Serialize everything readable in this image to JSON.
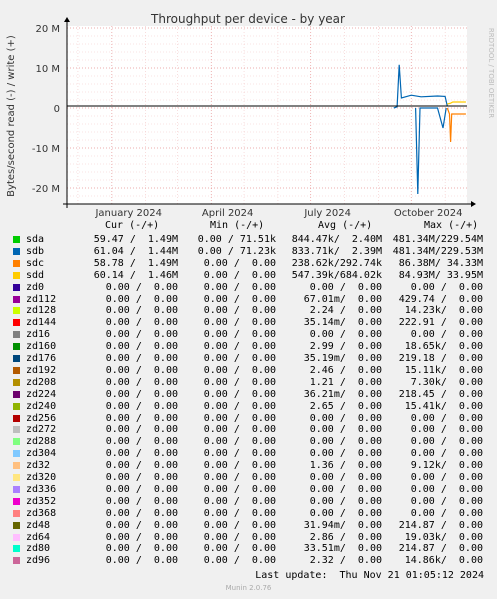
{
  "chart_data": {
    "type": "line",
    "title": "Throughput per device - by year",
    "ylabel": "Bytes/second read (-) / write (+)",
    "y_ticks": [
      "20 M",
      "10 M",
      "0",
      "-10 M",
      "-20 M"
    ],
    "y_tick_values": [
      20,
      10,
      0,
      -10,
      -20
    ],
    "ylim": [
      -24,
      20
    ],
    "x_ticks": [
      "January 2024",
      "April 2024",
      "July 2024",
      "October 2024"
    ],
    "xlim": [
      "2023-11-21",
      "2024-11-21"
    ],
    "side_label": "RRDTOOL / TOBI OETIKER",
    "series": [
      {
        "name": "sdb",
        "color": "#0066b3",
        "points": [
          [
            "2024-09-15",
            0
          ],
          [
            "2024-09-18",
            0.3
          ],
          [
            "2024-09-20",
            10.8
          ],
          [
            "2024-09-22",
            2.5
          ],
          [
            "2024-10-01",
            3.2
          ],
          [
            "2024-10-10",
            2.8
          ],
          [
            "2024-10-25",
            3.0
          ],
          [
            "2024-11-01",
            2.9
          ],
          [
            "2024-11-03",
            0.5
          ]
        ]
      },
      {
        "name": "sdb",
        "color": "#0066b3",
        "points": [
          [
            "2024-10-05",
            0
          ],
          [
            "2024-10-07",
            -21.5
          ],
          [
            "2024-10-09",
            0
          ],
          [
            "2024-10-25",
            0
          ],
          [
            "2024-10-30",
            -5.0
          ],
          [
            "2024-11-02",
            0
          ]
        ]
      },
      {
        "name": "sdc",
        "color": "#ff8000",
        "points": [
          [
            "2024-11-03",
            0
          ],
          [
            "2024-11-05",
            -1.5
          ],
          [
            "2024-11-06",
            -8.5
          ],
          [
            "2024-11-07",
            -1.5
          ],
          [
            "2024-11-20",
            -1.5
          ]
        ]
      },
      {
        "name": "sdd",
        "color": "#ffcc00",
        "points": [
          [
            "2024-11-03",
            1.0
          ],
          [
            "2024-11-06",
            1.2
          ],
          [
            "2024-11-08",
            1.5
          ],
          [
            "2024-11-20",
            1.5
          ]
        ]
      }
    ]
  },
  "legend": {
    "headers": {
      "cur": "Cur (-/+)",
      "min": "Min (-/+)",
      "avg": "Avg (-/+)",
      "max": "Max (-/+)"
    },
    "rows": [
      {
        "name": "sda",
        "color": "#00cc00",
        "cur": "59.47 /  1.49M",
        "min": "0.00 / 71.51k",
        "avg": "844.47k/  2.40M",
        "max": "481.34M/229.54M"
      },
      {
        "name": "sdb",
        "color": "#0066b3",
        "cur": "61.04 /  1.44M",
        "min": "0.00 / 71.23k",
        "avg": "833.71k/  2.39M",
        "max": "481.34M/229.53M"
      },
      {
        "name": "sdc",
        "color": "#ff8000",
        "cur": "58.78 /  1.49M",
        "min": "0.00 /  0.00",
        "avg": "238.62k/292.74k",
        "max": "86.38M/ 34.33M"
      },
      {
        "name": "sdd",
        "color": "#ffcc00",
        "cur": "60.14 /  1.46M",
        "min": "0.00 /  0.00",
        "avg": "547.39k/684.02k",
        "max": "84.93M/ 33.95M"
      },
      {
        "name": "zd0",
        "color": "#330099",
        "cur": "0.00 /  0.00",
        "min": "0.00 /  0.00",
        "avg": "0.00 /  0.00",
        "max": "0.00 /  0.00"
      },
      {
        "name": "zd112",
        "color": "#990099",
        "cur": "0.00 /  0.00",
        "min": "0.00 /  0.00",
        "avg": "67.01m/  0.00",
        "max": "429.74 /  0.00"
      },
      {
        "name": "zd128",
        "color": "#ccff00",
        "cur": "0.00 /  0.00",
        "min": "0.00 /  0.00",
        "avg": "2.24 /  0.00",
        "max": "14.23k/  0.00"
      },
      {
        "name": "zd144",
        "color": "#ff0000",
        "cur": "0.00 /  0.00",
        "min": "0.00 /  0.00",
        "avg": "35.14m/  0.00",
        "max": "222.91 /  0.00"
      },
      {
        "name": "zd16",
        "color": "#808080",
        "cur": "0.00 /  0.00",
        "min": "0.00 /  0.00",
        "avg": "0.00 /  0.00",
        "max": "0.00 /  0.00"
      },
      {
        "name": "zd160",
        "color": "#008f00",
        "cur": "0.00 /  0.00",
        "min": "0.00 /  0.00",
        "avg": "2.99 /  0.00",
        "max": "18.65k/  0.00"
      },
      {
        "name": "zd176",
        "color": "#00487d",
        "cur": "0.00 /  0.00",
        "min": "0.00 /  0.00",
        "avg": "35.19m/  0.00",
        "max": "219.18 /  0.00"
      },
      {
        "name": "zd192",
        "color": "#b35a00",
        "cur": "0.00 /  0.00",
        "min": "0.00 /  0.00",
        "avg": "2.46 /  0.00",
        "max": "15.11k/  0.00"
      },
      {
        "name": "zd208",
        "color": "#b38f00",
        "cur": "0.00 /  0.00",
        "min": "0.00 /  0.00",
        "avg": "1.21 /  0.00",
        "max": "7.30k/  0.00"
      },
      {
        "name": "zd224",
        "color": "#6b006b",
        "cur": "0.00 /  0.00",
        "min": "0.00 /  0.00",
        "avg": "36.21m/  0.00",
        "max": "218.45 /  0.00"
      },
      {
        "name": "zd240",
        "color": "#8fb300",
        "cur": "0.00 /  0.00",
        "min": "0.00 /  0.00",
        "avg": "2.65 /  0.00",
        "max": "15.41k/  0.00"
      },
      {
        "name": "zd256",
        "color": "#b30000",
        "cur": "0.00 /  0.00",
        "min": "0.00 /  0.00",
        "avg": "0.00 /  0.00",
        "max": "0.00 /  0.00"
      },
      {
        "name": "zd272",
        "color": "#bebebe",
        "cur": "0.00 /  0.00",
        "min": "0.00 /  0.00",
        "avg": "0.00 /  0.00",
        "max": "0.00 /  0.00"
      },
      {
        "name": "zd288",
        "color": "#80ff80",
        "cur": "0.00 /  0.00",
        "min": "0.00 /  0.00",
        "avg": "0.00 /  0.00",
        "max": "0.00 /  0.00"
      },
      {
        "name": "zd304",
        "color": "#80c9ff",
        "cur": "0.00 /  0.00",
        "min": "0.00 /  0.00",
        "avg": "0.00 /  0.00",
        "max": "0.00 /  0.00"
      },
      {
        "name": "zd32",
        "color": "#ffc080",
        "cur": "0.00 /  0.00",
        "min": "0.00 /  0.00",
        "avg": "1.36 /  0.00",
        "max": "9.12k/  0.00"
      },
      {
        "name": "zd320",
        "color": "#ffe680",
        "cur": "0.00 /  0.00",
        "min": "0.00 /  0.00",
        "avg": "0.00 /  0.00",
        "max": "0.00 /  0.00"
      },
      {
        "name": "zd336",
        "color": "#aa80ff",
        "cur": "0.00 /  0.00",
        "min": "0.00 /  0.00",
        "avg": "0.00 /  0.00",
        "max": "0.00 /  0.00"
      },
      {
        "name": "zd352",
        "color": "#ee00cc",
        "cur": "0.00 /  0.00",
        "min": "0.00 /  0.00",
        "avg": "0.00 /  0.00",
        "max": "0.00 /  0.00"
      },
      {
        "name": "zd368",
        "color": "#ff8080",
        "cur": "0.00 /  0.00",
        "min": "0.00 /  0.00",
        "avg": "0.00 /  0.00",
        "max": "0.00 /  0.00"
      },
      {
        "name": "zd48",
        "color": "#666600",
        "cur": "0.00 /  0.00",
        "min": "0.00 /  0.00",
        "avg": "31.94m/  0.00",
        "max": "214.87 /  0.00"
      },
      {
        "name": "zd64",
        "color": "#ffbfff",
        "cur": "0.00 /  0.00",
        "min": "0.00 /  0.00",
        "avg": "2.86 /  0.00",
        "max": "19.03k/  0.00"
      },
      {
        "name": "zd80",
        "color": "#00ffcc",
        "cur": "0.00 /  0.00",
        "min": "0.00 /  0.00",
        "avg": "33.51m/  0.00",
        "max": "214.87 /  0.00"
      },
      {
        "name": "zd96",
        "color": "#cc6699",
        "cur": "0.00 /  0.00",
        "min": "0.00 /  0.00",
        "avg": "2.32 /  0.00",
        "max": "14.86k/  0.00"
      }
    ]
  },
  "footer": {
    "last_update": "Last update:  Thu Nov 21 01:05:12 2024",
    "munin": "Munin 2.0.76"
  }
}
